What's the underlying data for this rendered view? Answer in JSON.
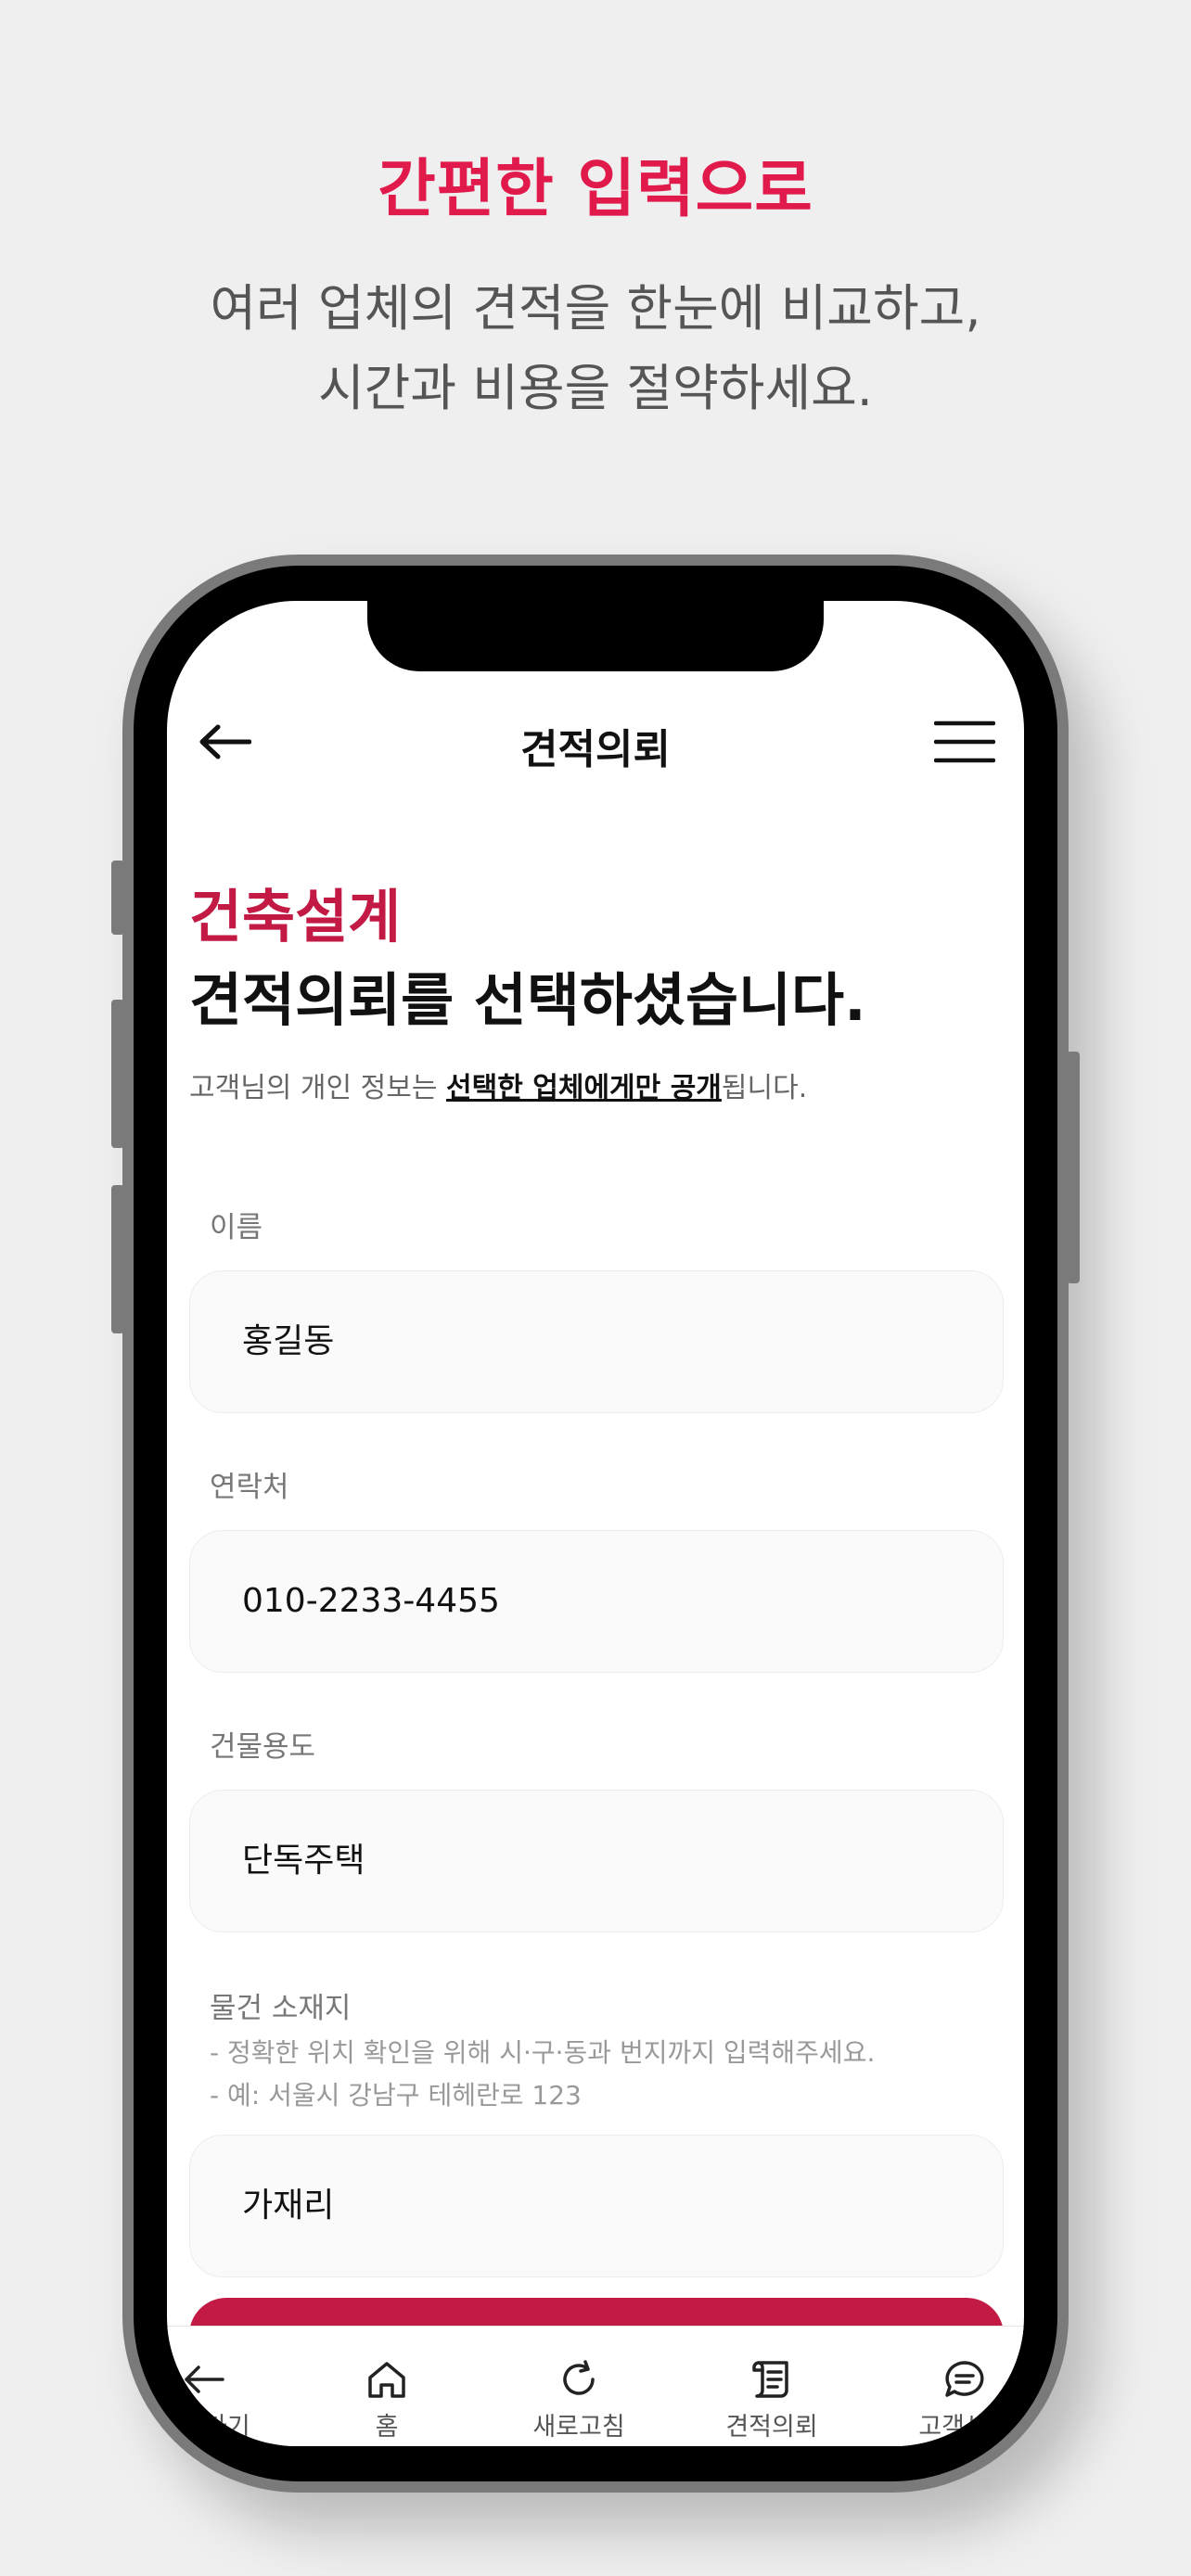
{
  "promo": {
    "title": "간편한 입력으로",
    "subtitle_line1": "여러 업체의 견적을 한눈에 비교하고,",
    "subtitle_line2": "시간과 비용을 절약하세요."
  },
  "header": {
    "title": "견적의뢰",
    "back_icon": "arrow-left-icon",
    "menu_icon": "hamburger-menu-icon"
  },
  "form": {
    "category": "건축설계",
    "headline": "견적의뢰를 선택하셨습니다.",
    "notice_prefix": "고객님의 개인 정보는 ",
    "notice_emphasis": "선택한 업체에게만 공개",
    "notice_suffix": "됩니다.",
    "name_label": "이름",
    "name_value": "홍길동",
    "contact_label": "연락처",
    "contact_value": "010-2233-4455",
    "building_use_label": "건물용도",
    "building_use_value": "단독주택",
    "location_label": "물건 소재지",
    "location_hint1": "- 정확한 위치 확인을 위해 시·구·동과 번지까지 입력해주세요.",
    "location_hint2": "- 예: 서울시 강남구 테헤란로 123",
    "location_value": "가재리"
  },
  "colors": {
    "accent": "#c21a44",
    "promo_title": "#e11a4c"
  },
  "tabbar": {
    "items": [
      {
        "label": "뒤로가기",
        "icon": "arrow-left-icon"
      },
      {
        "label": "홈",
        "icon": "home-icon"
      },
      {
        "label": "새로고침",
        "icon": "refresh-icon"
      },
      {
        "label": "견적의뢰",
        "icon": "scroll-document-icon"
      },
      {
        "label": "고객센터",
        "icon": "chat-bubble-icon"
      }
    ]
  }
}
